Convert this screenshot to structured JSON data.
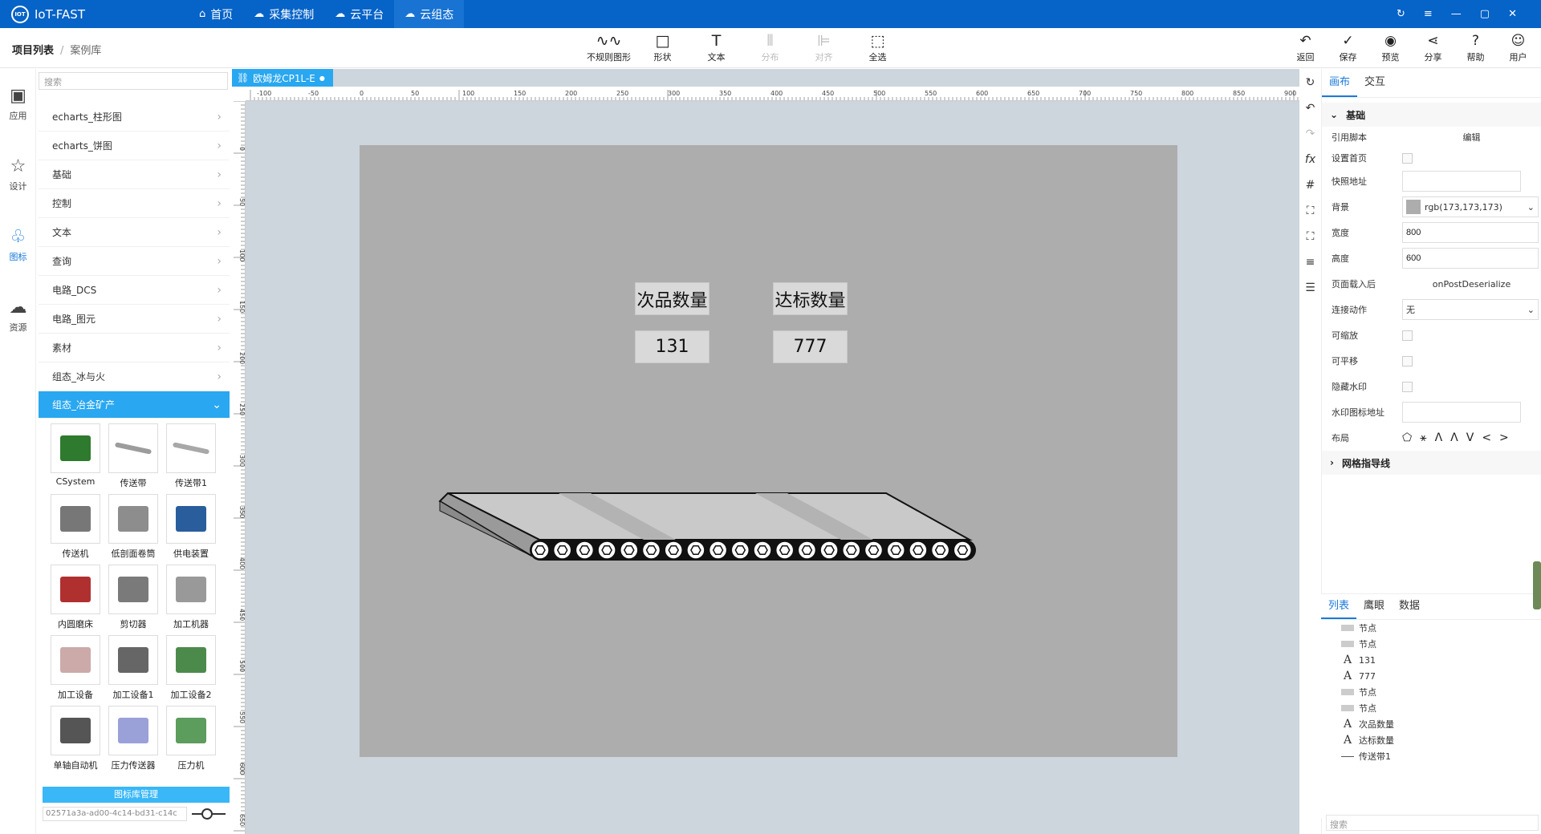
{
  "app": {
    "title": "IoT-FAST",
    "logo_text": "IOT"
  },
  "topnav": [
    {
      "label": "首页",
      "icon": "home-icon"
    },
    {
      "label": "采集控制",
      "icon": "cloud-icon"
    },
    {
      "label": "云平台",
      "icon": "cloud-platform-icon"
    },
    {
      "label": "云组态",
      "icon": "cloud-config-icon"
    }
  ],
  "breadcrumb": {
    "root": "项目列表",
    "sep": "/",
    "current": "案例库"
  },
  "tools": [
    {
      "label": "不规则图形",
      "icon": "∿∿"
    },
    {
      "label": "形状",
      "icon": "□"
    },
    {
      "label": "文本",
      "icon": "T"
    },
    {
      "label": "分布",
      "icon": "⫴"
    },
    {
      "label": "对齐",
      "icon": "⊫"
    },
    {
      "label": "全选",
      "icon": "⬚"
    }
  ],
  "rtools": [
    {
      "label": "返回",
      "icon": "↶"
    },
    {
      "label": "保存",
      "icon": "✓"
    },
    {
      "label": "预览",
      "icon": "◉"
    },
    {
      "label": "分享",
      "icon": "⋖"
    },
    {
      "label": "帮助",
      "icon": "?"
    },
    {
      "label": "用户",
      "icon": "☺"
    }
  ],
  "rail": [
    {
      "label": "应用",
      "icon": "🖼"
    },
    {
      "label": "设计",
      "icon": "☆"
    },
    {
      "label": "图标",
      "icon": "♧"
    },
    {
      "label": "资源",
      "icon": "☁"
    }
  ],
  "library": {
    "search_placeholder": "搜索",
    "categories": [
      "echarts_柱形图",
      "echarts_饼图",
      "基础",
      "控制",
      "文本",
      "查询",
      "电路_DCS",
      "电路_图元",
      "素材",
      "组态_冰与火"
    ],
    "open_category": "组态_冶金矿产",
    "items": [
      "CSystem",
      "传送带",
      "传送带1",
      "传送机",
      "低剖面卷筒",
      "供电装置",
      "内圆磨床",
      "剪切器",
      "加工机器",
      "加工设备",
      "加工设备1",
      "加工设备2",
      "单轴自动机",
      "压力传送器",
      "压力机"
    ],
    "manage_label": "图标库管理",
    "id_value": "02571a3a-ad00-4c14-bd31-c14c"
  },
  "doc": {
    "tab": "欧姆龙CP1L-E"
  },
  "ruler": {
    "h_ticks": [
      "-100",
      "-50",
      "0",
      "50",
      "100",
      "150",
      "200",
      "250",
      "300",
      "350",
      "400",
      "450",
      "500",
      "550",
      "600",
      "650",
      "700",
      "750",
      "800",
      "850",
      "900"
    ],
    "v_ticks": [
      "0",
      "50",
      "100",
      "150",
      "200",
      "250",
      "300",
      "350",
      "400",
      "450",
      "500",
      "550",
      "600",
      "650"
    ]
  },
  "stage": {
    "label_defective": "次品数量",
    "label_qualified": "达标数量",
    "value_defective": "131",
    "value_qualified": "777",
    "background": "#adadad"
  },
  "right": {
    "tabs": [
      "画布",
      "交互"
    ],
    "section_basic": "基础",
    "section_grid": "网格指导线",
    "props": {
      "script_label": "引用脚本",
      "script_value": "编辑",
      "home_label": "设置首页",
      "snapshot_label": "快照地址",
      "snapshot_value": "",
      "bg_label": "背景",
      "bg_value": "rgb(173,173,173)",
      "width_label": "宽度",
      "width_value": "800",
      "height_label": "高度",
      "height_value": "600",
      "onload_label": "页面载入后",
      "onload_value": "onPostDeserialize",
      "link_label": "连接动作",
      "link_value": "无",
      "zoom_label": "可缩放",
      "pan_label": "可平移",
      "wm_label": "隐藏水印",
      "wmurl_label": "水印图标地址",
      "wmurl_value": "",
      "layout_label": "布局"
    },
    "layout_icons": [
      "⬠",
      "⚹",
      "Ʌ",
      "Ʌ",
      "V",
      "<",
      ">"
    ]
  },
  "tree": {
    "tabs": [
      "列表",
      "鹰眼",
      "数据"
    ],
    "nodes": [
      {
        "type": "rect",
        "label": "节点"
      },
      {
        "type": "rect",
        "label": "节点"
      },
      {
        "type": "text",
        "label": "131"
      },
      {
        "type": "text",
        "label": "777"
      },
      {
        "type": "rect",
        "label": "节点"
      },
      {
        "type": "rect",
        "label": "节点"
      },
      {
        "type": "text",
        "label": "次品数量"
      },
      {
        "type": "text",
        "label": "达标数量"
      },
      {
        "type": "line",
        "label": "传送带1"
      }
    ],
    "search_placeholder": "搜索"
  },
  "colors": {
    "topbar": "#0663c7",
    "accent": "#29a7f0",
    "canvas_bg": "#cdd5dd"
  }
}
